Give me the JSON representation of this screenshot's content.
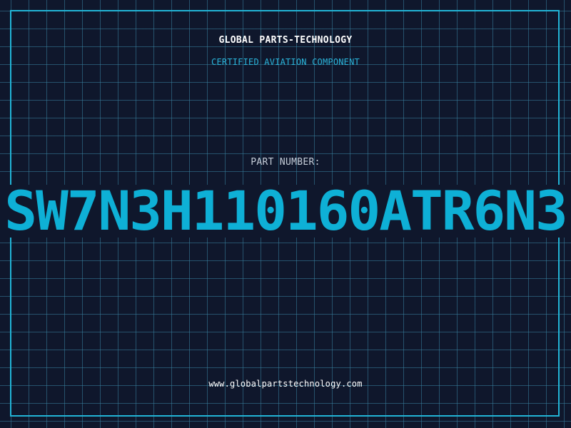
{
  "header": {
    "company": "GLOBAL PARTS-TECHNOLOGY",
    "subtitle": "CERTIFIED AVIATION COMPONENT"
  },
  "part": {
    "label": "PART NUMBER:",
    "number": "SW7N3H110160ATR6N3"
  },
  "footer": {
    "website": "www.globalpartstechnology.com"
  },
  "colors": {
    "background": "#0f172c",
    "grid": "#38829f",
    "accent": "#0eb0d6",
    "frame": "#22b4d6",
    "title": "#ffffff",
    "label": "#c6ced9"
  }
}
